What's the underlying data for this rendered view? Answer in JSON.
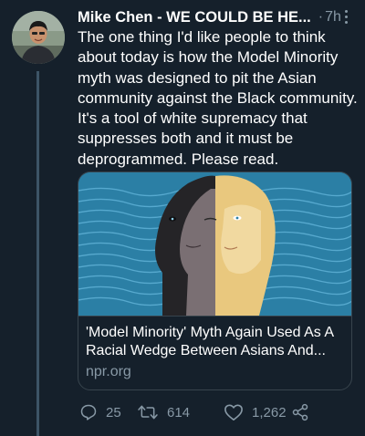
{
  "tweet": {
    "author_name": "Mike Chen - WE COULD BE HE...",
    "separator": "·",
    "time": "7h",
    "text": "The one thing I'd like people to think about today is how the Model Minority myth was designed to pit the Asian community against the Black community. It's a tool of white supremacy that suppresses both and it must be deprogrammed. Please read."
  },
  "card": {
    "title": "'Model Minority' Myth Again Used As A Racial Wedge Between Asians And...",
    "domain": "npr.org"
  },
  "actions": {
    "reply_count": "25",
    "retweet_count": "614",
    "like_count": "1,262"
  },
  "icons": {
    "reply": "reply-icon",
    "retweet": "retweet-icon",
    "like": "heart-icon",
    "share": "share-icon",
    "more": "more-icon"
  },
  "colors": {
    "background": "#15202b",
    "secondary_text": "#8899a6",
    "border": "#38444d",
    "card_image_bg": "#2b7fa5"
  }
}
